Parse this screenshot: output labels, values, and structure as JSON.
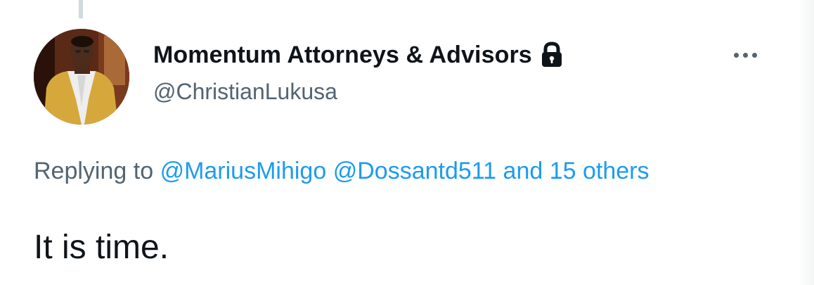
{
  "author": {
    "display_name": "Momentum Attorneys & Advisors",
    "handle": "@ChristianLukusa",
    "avatar_icon": "profile-photo",
    "protected_icon": "lock-icon"
  },
  "menu": {
    "icon": "more-horizontal-icon"
  },
  "reply_context": {
    "prefix": "Replying to",
    "mention_1": "@MariusMihigo",
    "mention_2": "@Dossantd511",
    "others": "and 15 others"
  },
  "tweet": {
    "text": "It is time."
  },
  "colors": {
    "primary_text": "#0f1419",
    "secondary_text": "#536471",
    "link": "#1d9bf0",
    "thread_line": "#cfd9de"
  }
}
